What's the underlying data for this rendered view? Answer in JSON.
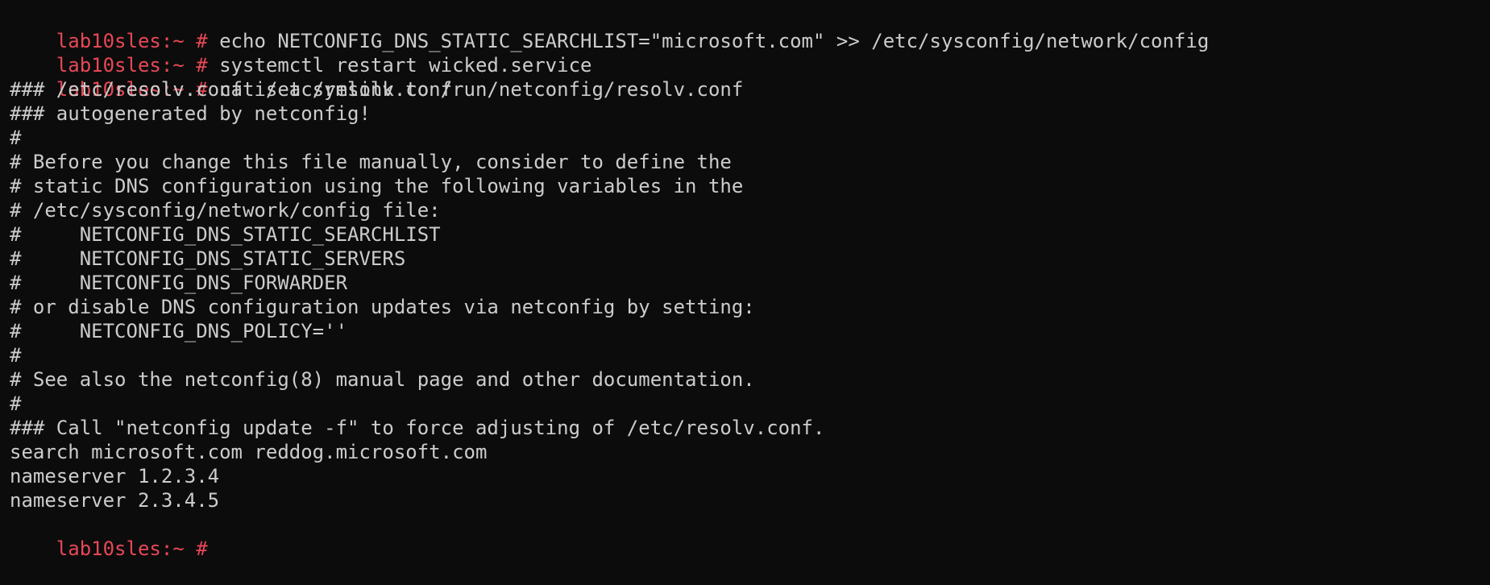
{
  "terminal": {
    "prompt": "lab10sles:~ # ",
    "colors": {
      "background": "#0c0c0c",
      "foreground": "#cccccc",
      "prompt": "#e74856"
    },
    "commands": [
      "echo NETCONFIG_DNS_STATIC_SEARCHLIST=\"microsoft.com\" >> /etc/sysconfig/network/config",
      "systemctl restart wicked.service",
      "cat /etc/resolv.conf"
    ],
    "output": [
      "### /etc/resolv.conf is a symlink to /run/netconfig/resolv.conf",
      "### autogenerated by netconfig!",
      "#",
      "# Before you change this file manually, consider to define the",
      "# static DNS configuration using the following variables in the",
      "# /etc/sysconfig/network/config file:",
      "#     NETCONFIG_DNS_STATIC_SEARCHLIST",
      "#     NETCONFIG_DNS_STATIC_SERVERS",
      "#     NETCONFIG_DNS_FORWARDER",
      "# or disable DNS configuration updates via netconfig by setting:",
      "#     NETCONFIG_DNS_POLICY=''",
      "#",
      "# See also the netconfig(8) manual page and other documentation.",
      "#",
      "### Call \"netconfig update -f\" to force adjusting of /etc/resolv.conf.",
      "search microsoft.com reddog.microsoft.com",
      "nameserver 1.2.3.4",
      "nameserver 2.3.4.5"
    ],
    "current_input": ""
  }
}
